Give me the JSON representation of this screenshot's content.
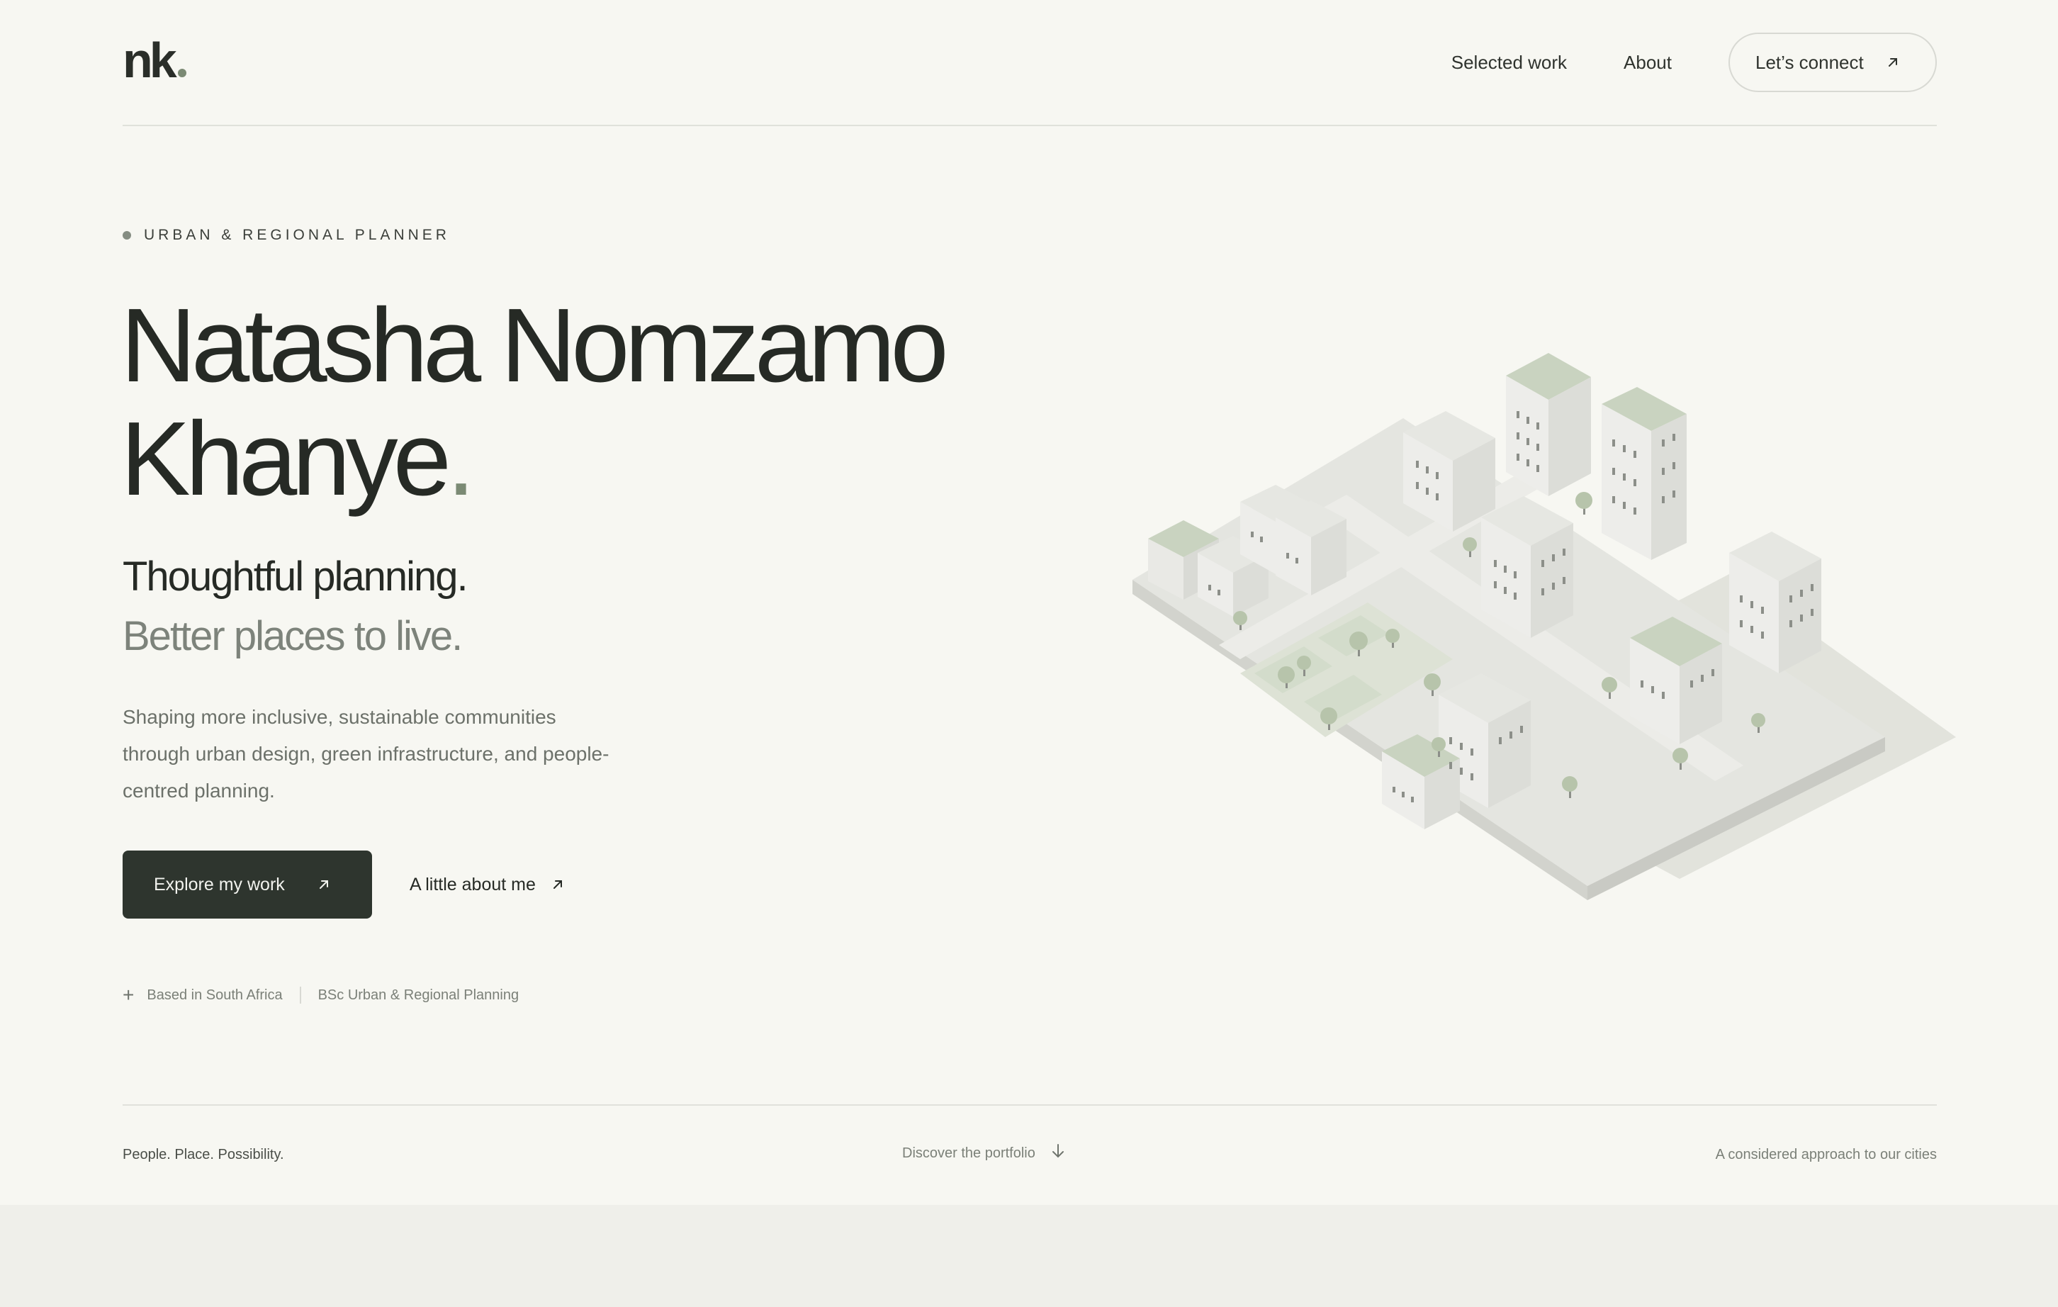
{
  "brand": {
    "logo_text": "nk"
  },
  "nav": {
    "items": [
      {
        "label": "Selected work"
      },
      {
        "label": "About"
      }
    ],
    "cta_label": "Let’s connect"
  },
  "hero": {
    "eyebrow": "URBAN & REGIONAL PLANNER",
    "name_line1": "Natasha Nomzamo",
    "name_line2": "Khanye",
    "name_punct": ".",
    "tagline_primary": "Thoughtful planning.",
    "tagline_secondary": "Better places to live.",
    "description": "Shaping more inclusive, sustainable communities through urban design, green infrastructure, and people-centred planning.",
    "primary_button": "Explore my work",
    "secondary_button": "A little about me",
    "meta": {
      "location": "Based in South Africa",
      "degree": "BSc Urban & Regional Planning"
    }
  },
  "footer": {
    "motto": "People. Place. Possibility.",
    "scroll_hint": "Discover the portfolio",
    "approach": "A considered approach to our cities"
  },
  "colors": {
    "background": "#f7f7f2",
    "text_dark": "#262a25",
    "accent_sage": "#7b8a74",
    "button_dark": "#2e352e"
  },
  "icons": {
    "arrow": "arrow-up-right-icon",
    "down": "arrow-down-icon",
    "plus": "plus-icon"
  }
}
